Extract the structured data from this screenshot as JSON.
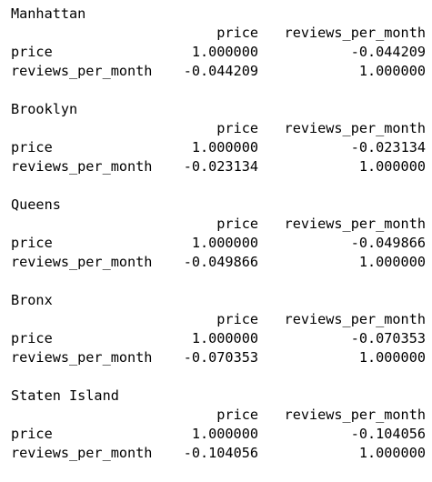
{
  "blocks": [
    {
      "title": "Manhattan",
      "header": [
        "",
        "price",
        "reviews_per_month"
      ],
      "rows": [
        [
          "price",
          "1.000000",
          "-0.044209"
        ],
        [
          "reviews_per_month",
          "-0.044209",
          "1.000000"
        ]
      ]
    },
    {
      "title": "Brooklyn",
      "header": [
        "",
        "price",
        "reviews_per_month"
      ],
      "rows": [
        [
          "price",
          "1.000000",
          "-0.023134"
        ],
        [
          "reviews_per_month",
          "-0.023134",
          "1.000000"
        ]
      ]
    },
    {
      "title": "Queens",
      "header": [
        "",
        "price",
        "reviews_per_month"
      ],
      "rows": [
        [
          "price",
          "1.000000",
          "-0.049866"
        ],
        [
          "reviews_per_month",
          "-0.049866",
          "1.000000"
        ]
      ]
    },
    {
      "title": "Bronx",
      "header": [
        "",
        "price",
        "reviews_per_month"
      ],
      "rows": [
        [
          "price",
          "1.000000",
          "-0.070353"
        ],
        [
          "reviews_per_month",
          "-0.070353",
          "1.000000"
        ]
      ]
    },
    {
      "title": "Staten Island",
      "header": [
        "",
        "price",
        "reviews_per_month"
      ],
      "rows": [
        [
          "price",
          "1.000000",
          "-0.104056"
        ],
        [
          "reviews_per_month",
          "-0.104056",
          "1.000000"
        ]
      ]
    }
  ]
}
